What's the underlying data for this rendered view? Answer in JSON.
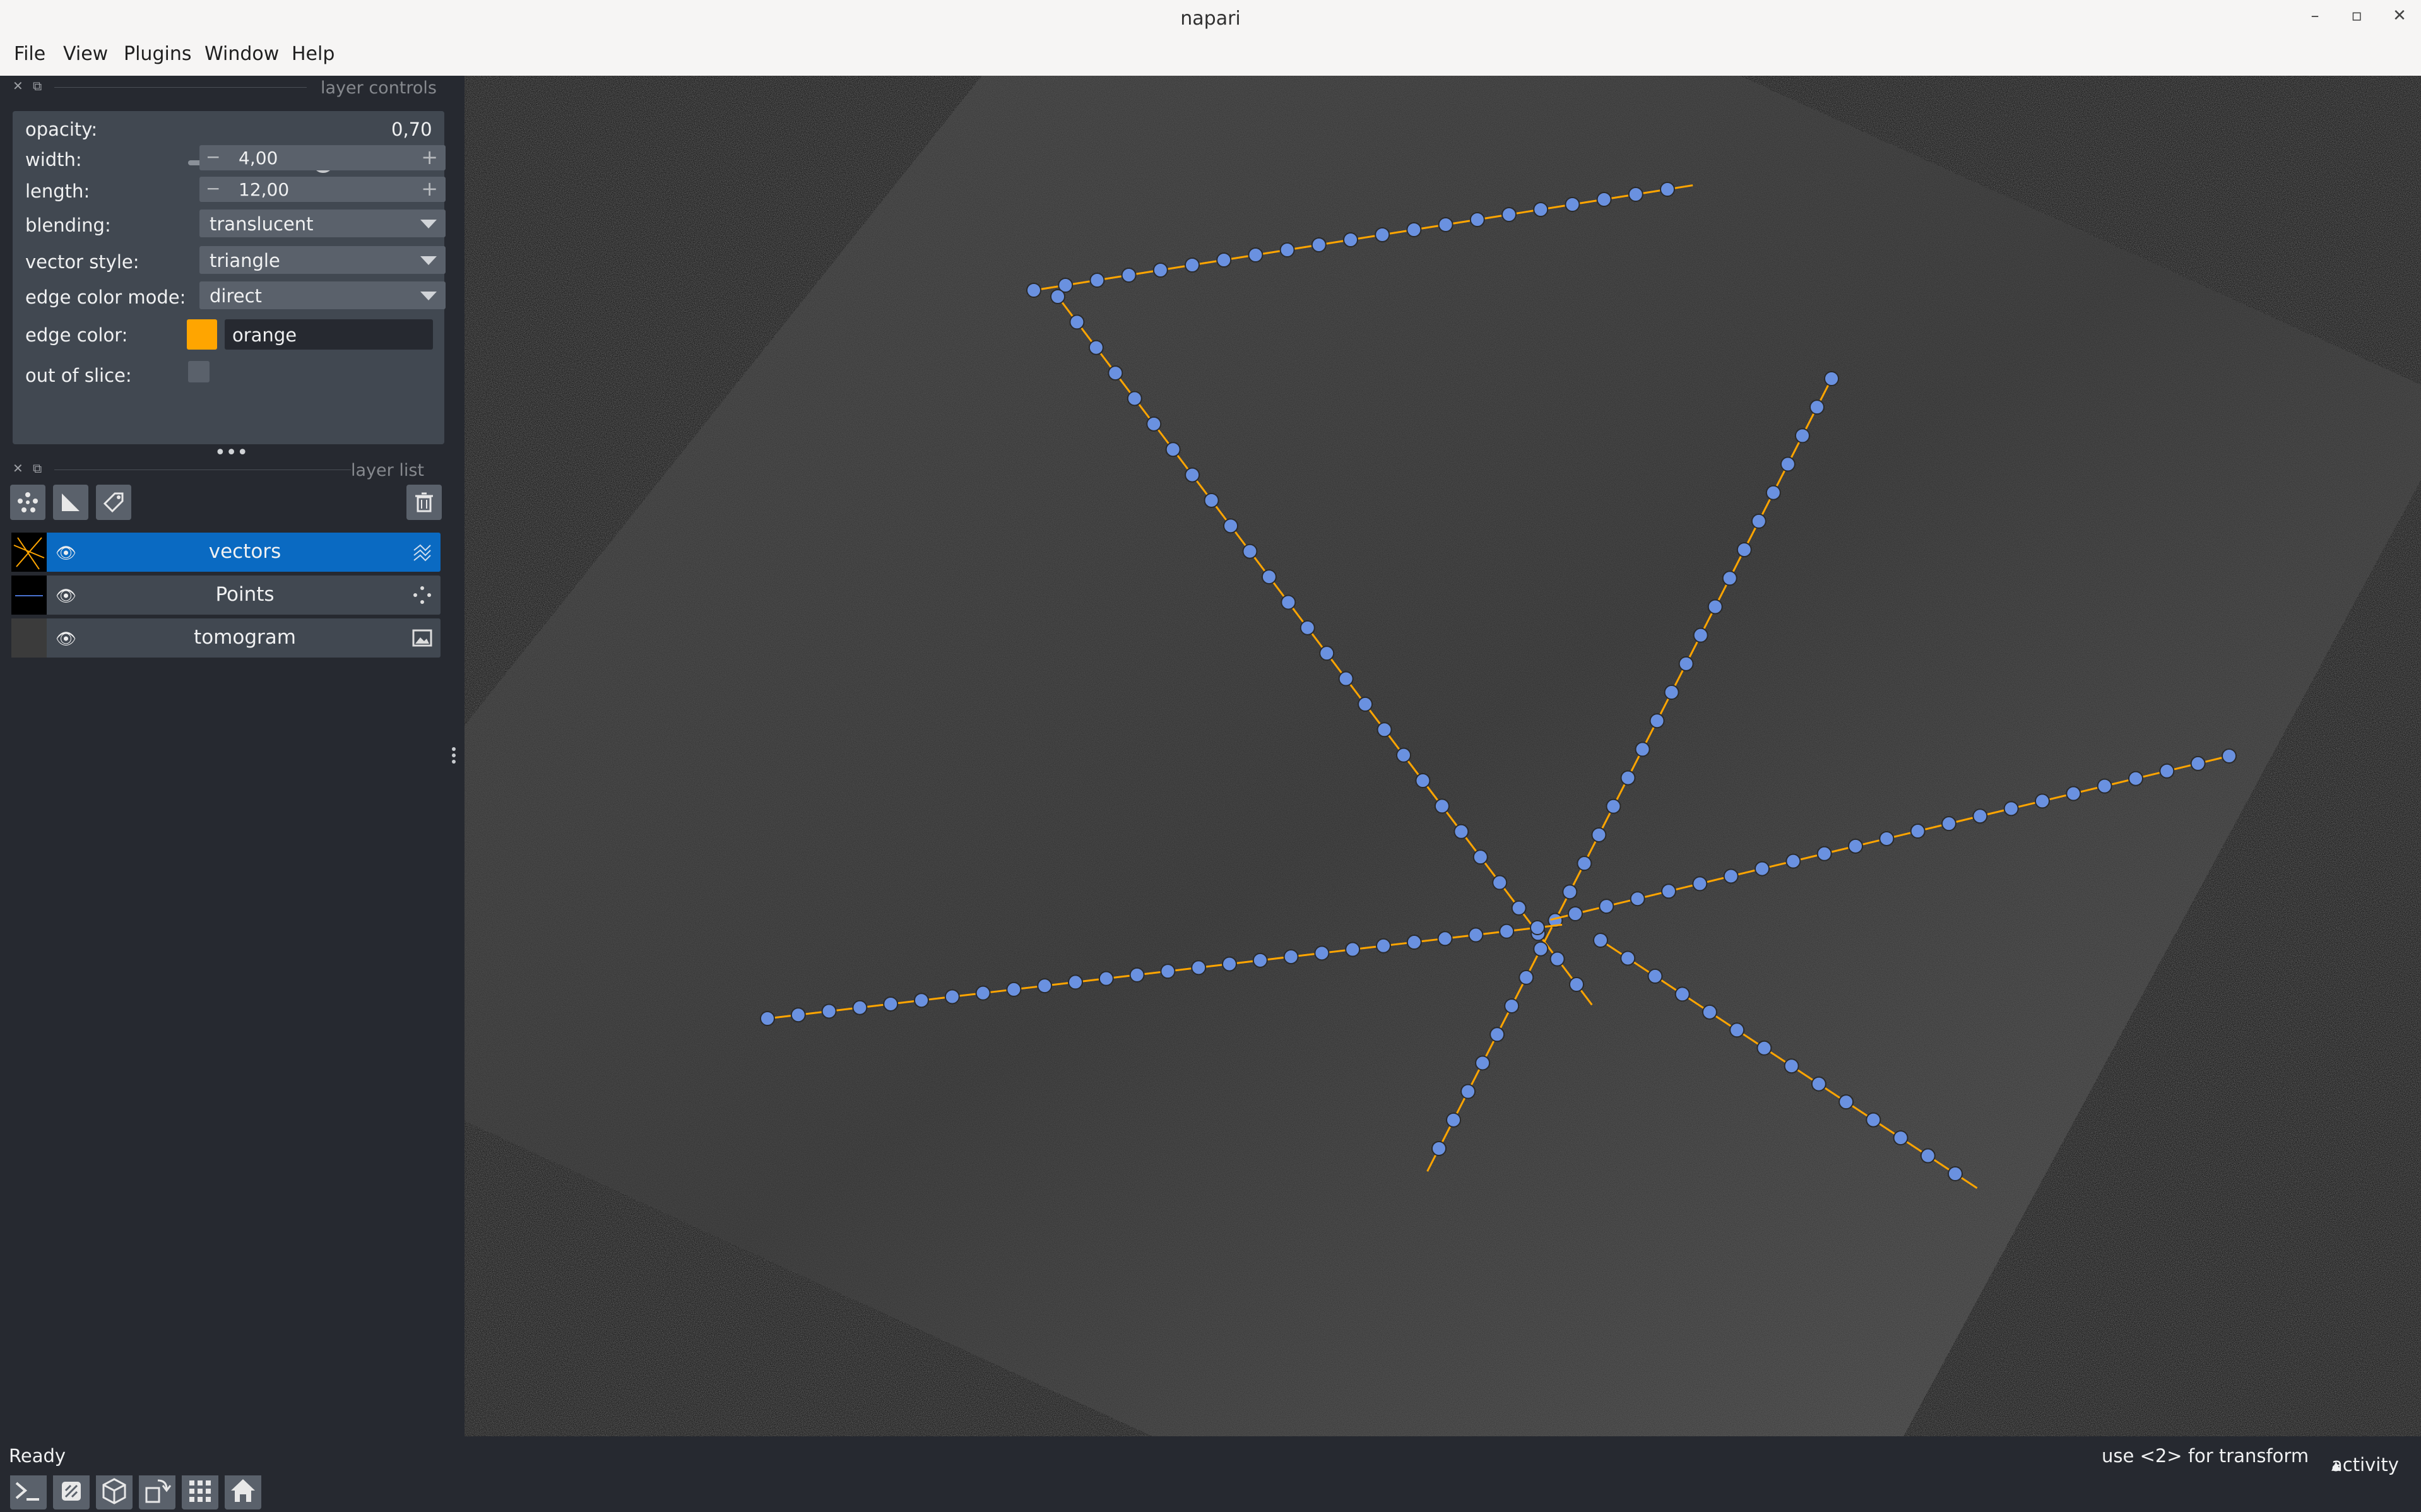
{
  "window": {
    "title": "napari"
  },
  "window_buttons": {
    "minimize": "–",
    "restore": "▫",
    "close": "✕"
  },
  "menu": [
    "File",
    "View",
    "Plugins",
    "Window",
    "Help"
  ],
  "layer_controls": {
    "header": "layer controls",
    "opacity": {
      "label": "opacity:",
      "value": "0,70",
      "fraction": 0.7
    },
    "width": {
      "label": "width:",
      "value": "4,00"
    },
    "length": {
      "label": "length:",
      "value": "12,00"
    },
    "blending": {
      "label": "blending:",
      "value": "translucent"
    },
    "vector_style": {
      "label": "vector style:",
      "value": "triangle"
    },
    "edge_color_mode": {
      "label": "edge color mode:",
      "value": "direct"
    },
    "edge_color": {
      "label": "edge color:",
      "value": "orange",
      "swatch": "#ffa500"
    },
    "out_of_slice": {
      "label": "out of slice:",
      "checked": false
    }
  },
  "layer_list": {
    "header": "layer list",
    "buttons": [
      "new-points-layer",
      "new-shapes-layer",
      "new-labels-layer",
      "delete-layer"
    ],
    "layers": [
      {
        "name": "vectors",
        "selected": true,
        "visible": true,
        "type_icon": "vectors-icon"
      },
      {
        "name": "Points",
        "selected": false,
        "visible": true,
        "type_icon": "points-icon"
      },
      {
        "name": "tomogram",
        "selected": false,
        "visible": true,
        "type_icon": "image-icon"
      }
    ]
  },
  "viewer_buttons": [
    "console",
    "ndisplay-2d-3d",
    "roll-dims",
    "transpose-dims",
    "grid-view",
    "reset-view"
  ],
  "status": {
    "left": "Ready",
    "hint": "use <2> for transform",
    "activity": "activity",
    "activity_arrow": "▴"
  },
  "colors": {
    "accent": "#0a6ac2",
    "panel": "#262930",
    "control_bg": "#414851",
    "point_fill": "#6a91e0",
    "vector": "#ffa500"
  },
  "icons": {
    "eye": "👁",
    "dock_close": "✕",
    "dock_float": "⧉"
  }
}
